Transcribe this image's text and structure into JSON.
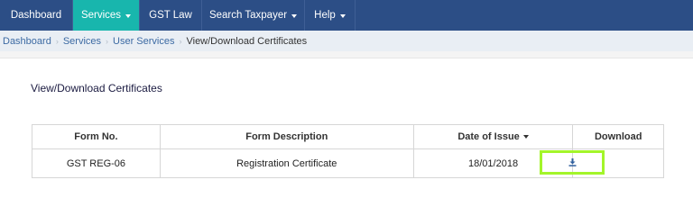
{
  "navbar": {
    "items": [
      {
        "label": "Dashboard",
        "active": false,
        "has_dropdown": false
      },
      {
        "label": "Services",
        "active": true,
        "has_dropdown": true
      },
      {
        "label": "GST Law",
        "active": false,
        "has_dropdown": false
      },
      {
        "label": "Search Taxpayer",
        "active": false,
        "has_dropdown": true
      },
      {
        "label": "Help",
        "active": false,
        "has_dropdown": true
      }
    ],
    "colors": {
      "background": "#2c4e86",
      "active": "#18b6ad"
    }
  },
  "breadcrumb": {
    "links": [
      "Dashboard",
      "Services",
      "User Services"
    ],
    "current": "View/Download Certificates"
  },
  "main": {
    "title": "View/Download Certificates",
    "table": {
      "headers": [
        "Form No.",
        "Form Description",
        "Date of Issue",
        "Download"
      ],
      "sorted_column": "Date of Issue",
      "rows": [
        {
          "form_no": "GST REG-06",
          "description": "Registration Certificate",
          "date": "18/01/2018",
          "download_icon": "download-icon"
        }
      ]
    },
    "highlight_color": "#a3f52a"
  }
}
